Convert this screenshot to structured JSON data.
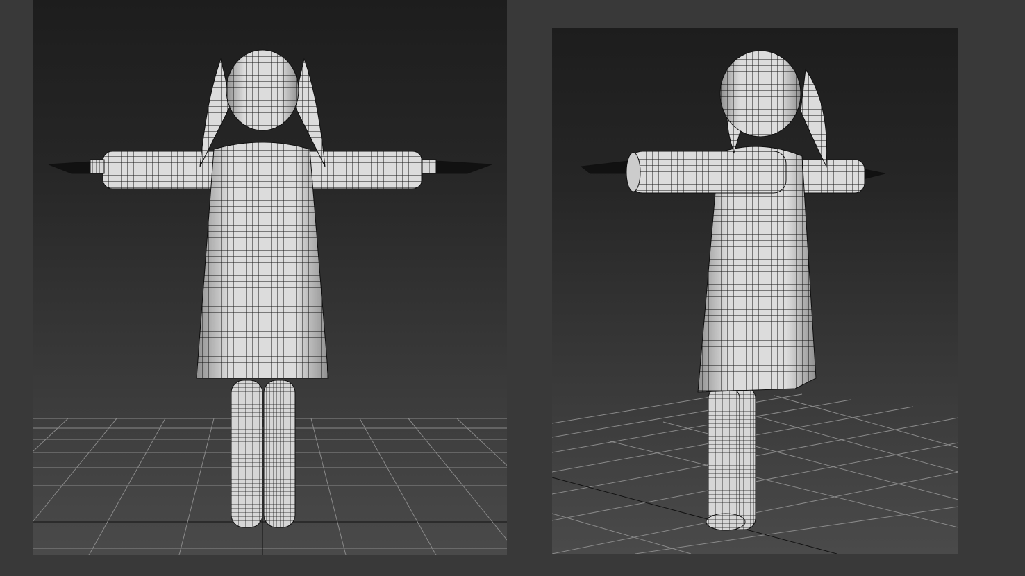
{
  "viewports": [
    {
      "view": "front"
    },
    {
      "view": "perspective"
    }
  ],
  "colors": {
    "page_background": "#393939",
    "viewport_top": "#1d1d1d",
    "viewport_bottom": "#4a4a4a",
    "grid_line": "#8a8a8a",
    "mesh_fill": "#dadada",
    "wire": "#111111"
  }
}
